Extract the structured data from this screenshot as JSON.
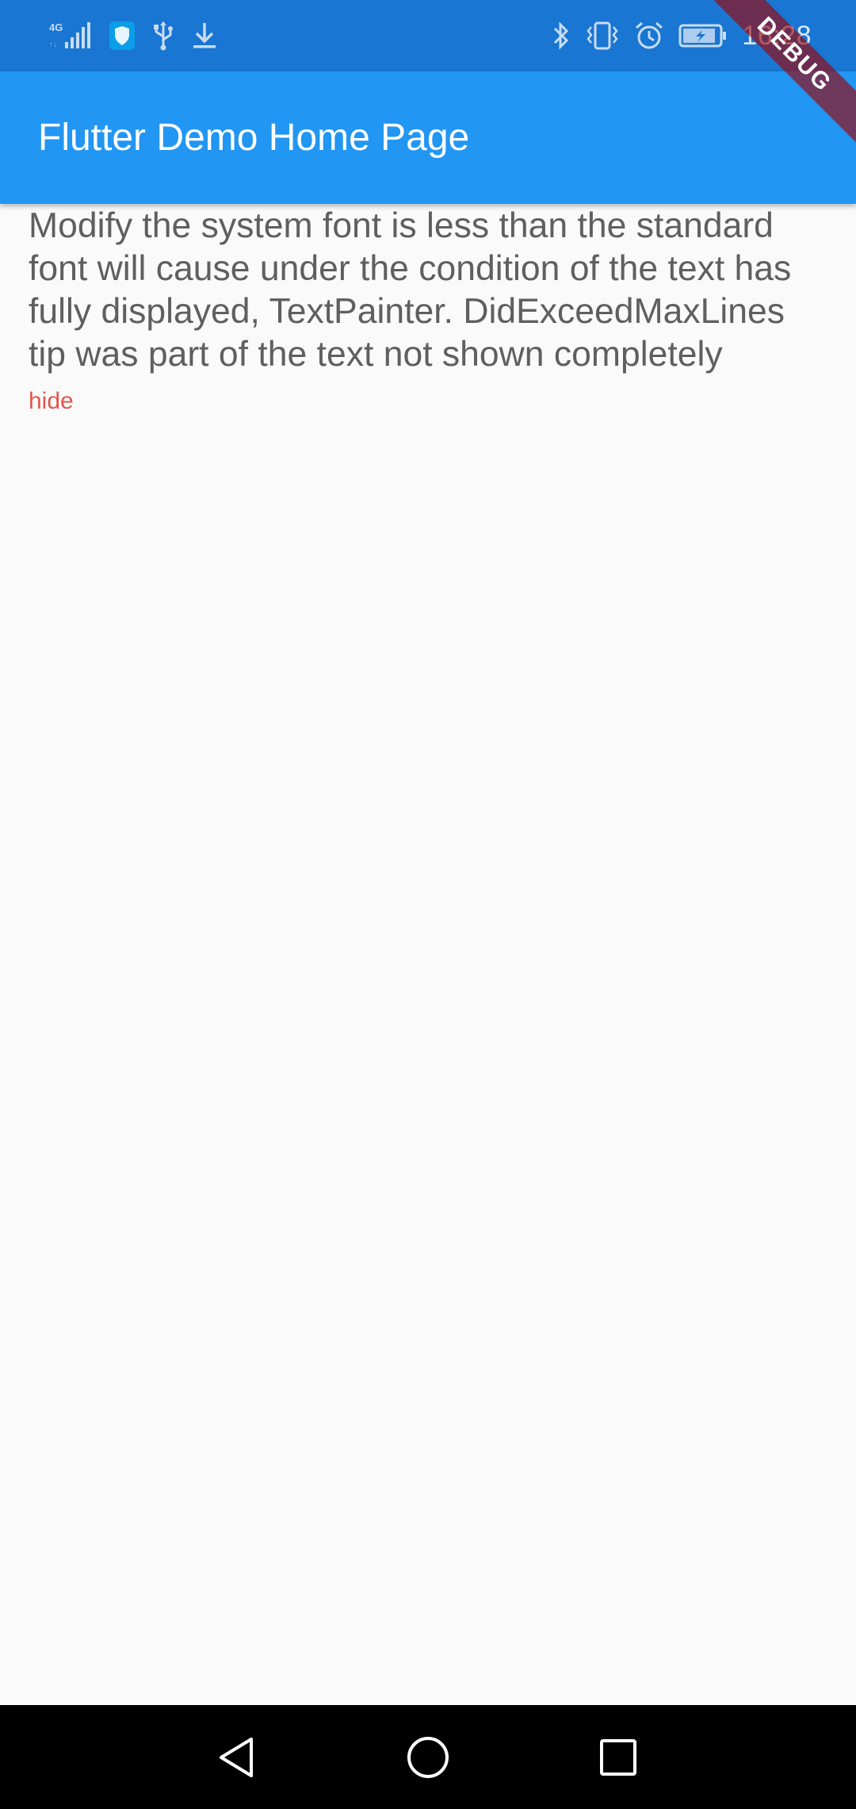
{
  "status_bar": {
    "time": "16:28",
    "network_label": "4G",
    "background": "#1976d2",
    "icons_left": [
      "signal-4g-icon",
      "shield-icon",
      "usb-icon",
      "download-icon"
    ],
    "icons_right": [
      "bluetooth-icon",
      "vibrate-icon",
      "alarm-icon",
      "battery-charging-icon"
    ]
  },
  "app_bar": {
    "title": "Flutter Demo Home Page",
    "background": "#2196f3"
  },
  "debug_banner": {
    "label": "DEBUG"
  },
  "content": {
    "body_text": "Modify the system font is less than the standard font will cause under the condition of the text has fully displayed, TextPainter. DidExceedMaxLines tip was part of the text not shown completely",
    "toggle_label": "hide",
    "toggle_color": "#e0574f"
  },
  "nav_bar": {
    "buttons": [
      "back-icon",
      "home-icon",
      "recents-icon"
    ]
  }
}
